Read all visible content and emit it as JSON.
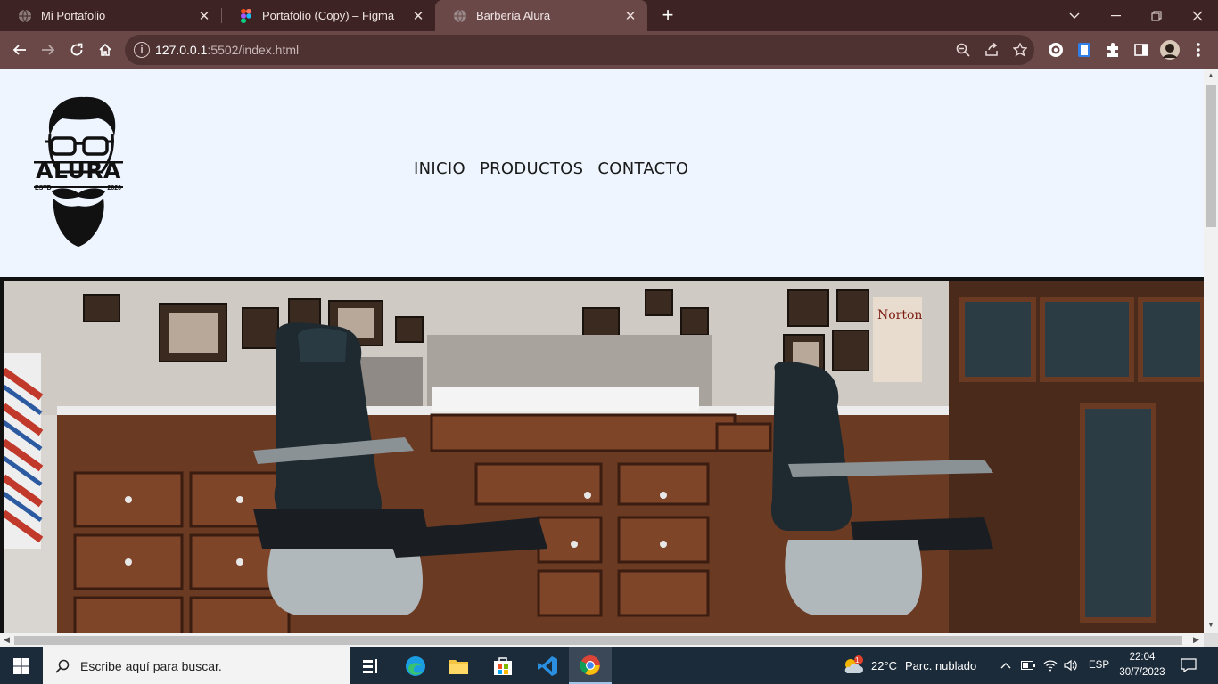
{
  "browser": {
    "tabs": [
      {
        "title": "Mi Portafolio"
      },
      {
        "title": "Portafolio (Copy) – Figma"
      },
      {
        "title": "Barbería Alura"
      }
    ],
    "url_host": "127.0.0.1",
    "url_path": ":5502/index.html"
  },
  "site": {
    "logo": {
      "text": "ALURA",
      "estd": "ESTD",
      "year": "2020"
    },
    "menu": [
      {
        "label": "INICIO"
      },
      {
        "label": "PRODUCTOS"
      },
      {
        "label": "CONTACTO"
      }
    ]
  },
  "taskbar": {
    "search_placeholder": "Escribe aquí para buscar.",
    "weather_temp": "22°C",
    "weather_text": "Parc. nublado",
    "weather_badge": "1",
    "language": "ESP",
    "time": "22:04",
    "date": "30/7/2023"
  },
  "colors": {
    "tab_bar": "#3d2323",
    "toolbar": "#6a4848",
    "page_bg": "#eef5ff",
    "taskbar": "#1c2b3a"
  }
}
